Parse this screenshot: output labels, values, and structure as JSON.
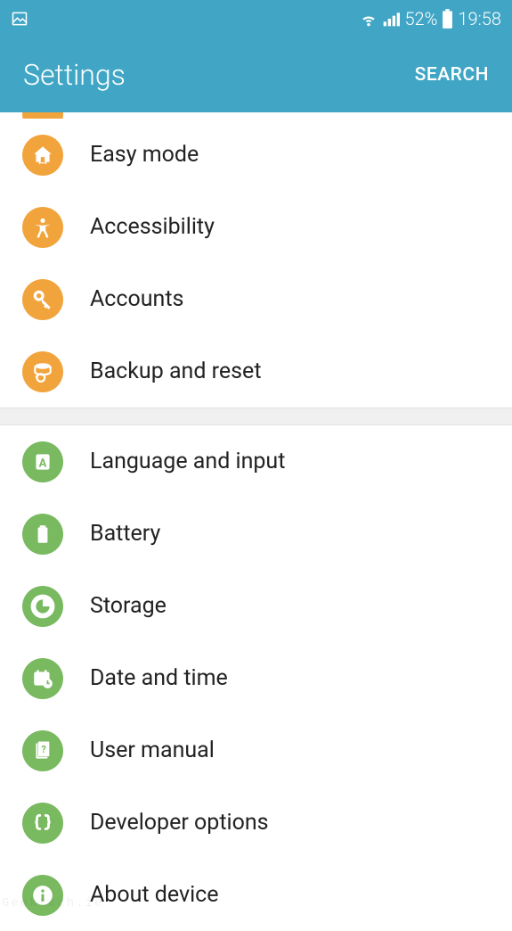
{
  "status": {
    "battery_pct": "52%",
    "time": "19:58"
  },
  "header": {
    "title": "Settings",
    "search_label": "SEARCH"
  },
  "colors": {
    "primary": "#41a6c5",
    "orange": "#f2a43c",
    "green": "#79b960"
  },
  "group_top": [
    {
      "label": "Easy mode",
      "icon": "home-swap-icon",
      "color": "orange"
    },
    {
      "label": "Accessibility",
      "icon": "accessibility-icon",
      "color": "orange"
    },
    {
      "label": "Accounts",
      "icon": "key-icon",
      "color": "orange"
    },
    {
      "label": "Backup and reset",
      "icon": "backup-icon",
      "color": "orange"
    }
  ],
  "group_bottom": [
    {
      "label": "Language and input",
      "icon": "letter-a-icon",
      "color": "green"
    },
    {
      "label": "Battery",
      "icon": "battery-icon",
      "color": "green"
    },
    {
      "label": "Storage",
      "icon": "storage-pie-icon",
      "color": "green"
    },
    {
      "label": "Date and time",
      "icon": "calendar-clock-icon",
      "color": "green"
    },
    {
      "label": "User manual",
      "icon": "manual-icon",
      "color": "green"
    },
    {
      "label": "Developer options",
      "icon": "braces-icon",
      "color": "green"
    },
    {
      "label": "About device",
      "icon": "info-icon",
      "color": "green"
    }
  ],
  "watermark": "Geektech.ie"
}
